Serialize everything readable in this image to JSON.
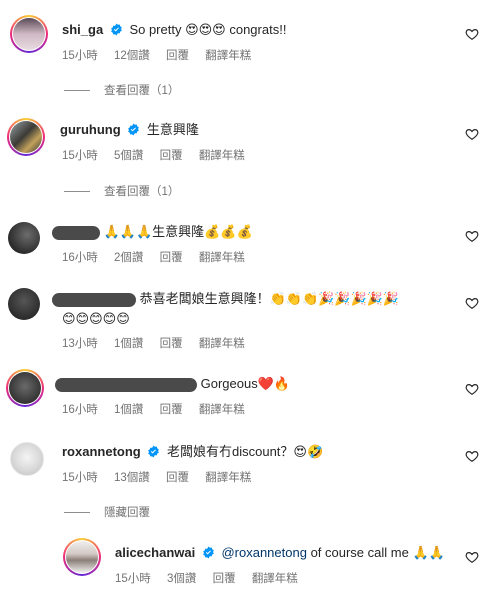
{
  "meta_actions": {
    "reply": "回覆",
    "translate": "翻譯年糕"
  },
  "comments": [
    {
      "username": "shi_ga",
      "text": "So pretty 😍😍😍 congrats!!",
      "time": "15小時",
      "likes": "12個讚",
      "view_replies": "查看回覆（1）"
    },
    {
      "username": "guruhung",
      "text": "生意興隆",
      "time": "15小時",
      "likes": "5個讚",
      "view_replies": "查看回覆（1）"
    },
    {
      "text": "🙏🙏🙏生意興隆💰💰💰",
      "time": "16小時",
      "likes": "2個讚"
    },
    {
      "text_line1": "恭喜老闆娘生意興隆！👏👏👏🎉🎉🎉🎉🎉",
      "text_line2": "😊😊😊😊😊",
      "time": "13小時",
      "likes": "1個讚"
    },
    {
      "text": "Gorgeous❤️🔥",
      "time": "16小時",
      "likes": "1個讚"
    },
    {
      "username": "roxannetong",
      "text": "老闆娘有冇discount？😍🤣",
      "time": "15小時",
      "likes": "13個讚",
      "hide_replies": "隱藏回覆"
    },
    {
      "username": "alicechanwai",
      "mention": "@roxannetong",
      "text": " of course call me 🙏🙏",
      "time": "15小時",
      "likes": "3個讚"
    }
  ]
}
